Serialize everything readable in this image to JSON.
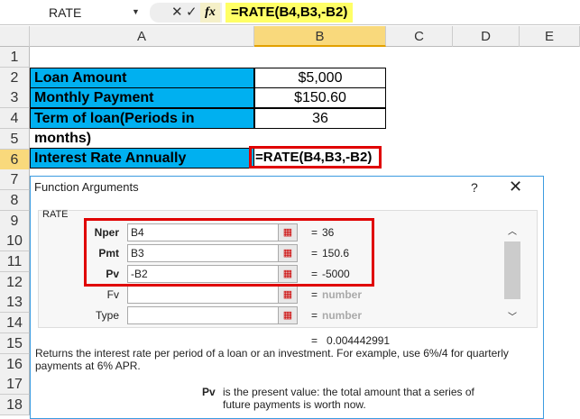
{
  "formula_bar": {
    "name_box": "RATE",
    "formula": "=RATE(B4,B3,-B2)",
    "cancel_icon": "✕",
    "enter_icon": "✓",
    "fx_label": "fx"
  },
  "columns": [
    "A",
    "B",
    "C",
    "D",
    "E"
  ],
  "rows": [
    "1",
    "2",
    "3",
    "4",
    "5",
    "6",
    "7",
    "8",
    "9",
    "10",
    "11",
    "12",
    "13",
    "14",
    "15",
    "16",
    "17",
    "18"
  ],
  "cells": {
    "a2": "Loan Amount",
    "b2": "$5,000",
    "a3": "Monthly Payment",
    "b3": "$150.60",
    "a4": "Term of loan(Periods in months)",
    "b4": "36",
    "a6": "Interest Rate Annually",
    "b6": "=RATE(B4,B3,-B2)"
  },
  "colors": {
    "label_fill": "#00b0f0",
    "highlight": "#e00000",
    "formula_highlight": "#ffff66"
  },
  "dialog": {
    "title": "Function Arguments",
    "help": "?",
    "close": "✕",
    "function_name": "RATE",
    "args": [
      {
        "label": "Nper",
        "value": "B4",
        "result": "36",
        "bold": true
      },
      {
        "label": "Pmt",
        "value": "B3",
        "result": "150.6",
        "bold": true
      },
      {
        "label": "Pv",
        "value": "-B2",
        "result": "-5000",
        "bold": true
      },
      {
        "label": "Fv",
        "value": "",
        "result": "number",
        "bold": false
      },
      {
        "label": "Type",
        "value": "",
        "result": "number",
        "bold": false
      }
    ],
    "equals": "=",
    "formula_result": "0.004442991",
    "description": "Returns the interest rate per period of a loan or an investment. For example, use 6%/4 for quarterly payments at 6% APR.",
    "arg_help_name": "Pv",
    "arg_help_text": "is the present value: the total amount that a series of future payments is worth now."
  }
}
